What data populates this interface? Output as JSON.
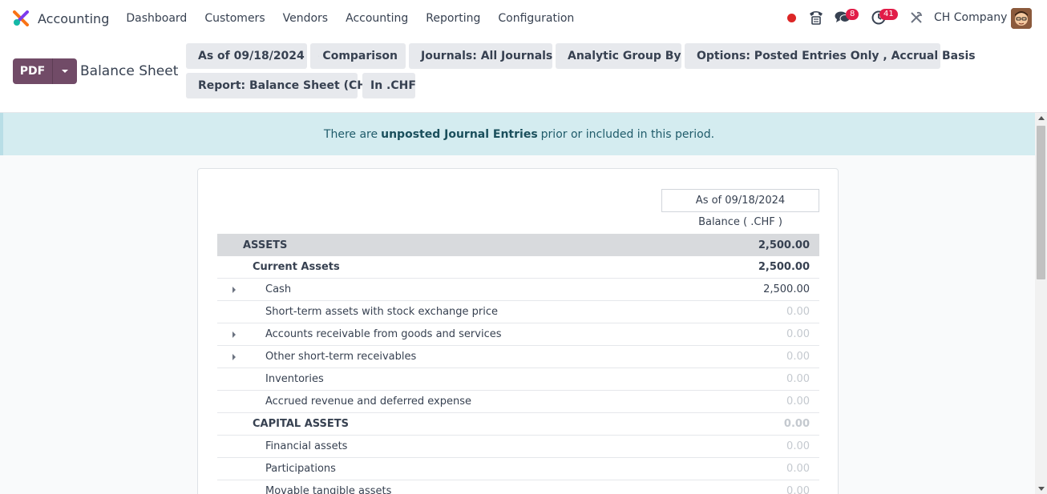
{
  "nav": {
    "app_title": "Accounting",
    "menu": [
      "Dashboard",
      "Customers",
      "Vendors",
      "Accounting",
      "Reporting",
      "Configuration"
    ],
    "messages_badge": "8",
    "activities_badge": "41",
    "company": "CH Company"
  },
  "control": {
    "pdf_label": "PDF",
    "page_title": "Balance Sheet",
    "filters": {
      "as_of": "As of 09/18/2024",
      "comparison": "Comparison",
      "journals": "Journals: All Journals",
      "analytic": "Analytic Group By",
      "options": "Options: Posted Entries Only , Accrual Basis",
      "report": "Report: Balance Sheet (CH)",
      "currency": "In .CHF"
    }
  },
  "alert": {
    "before": "There are",
    "link": "unposted Journal Entries",
    "after": "prior or included in this period."
  },
  "report": {
    "column_header": "As of 09/18/2024",
    "column_sub": "Balance ( .CHF )",
    "rows": [
      {
        "label": "ASSETS",
        "amount": "2,500.00"
      },
      {
        "label": "Current Assets",
        "amount": "2,500.00"
      },
      {
        "label": "Cash",
        "amount": "2,500.00"
      },
      {
        "label": "Short-term assets with stock exchange price",
        "amount": "0.00"
      },
      {
        "label": "Accounts receivable from goods and services",
        "amount": "0.00"
      },
      {
        "label": "Other short-term receivables",
        "amount": "0.00"
      },
      {
        "label": "Inventories",
        "amount": "0.00"
      },
      {
        "label": "Accrued revenue and deferred expense",
        "amount": "0.00"
      },
      {
        "label": "CAPITAL ASSETS",
        "amount": "0.00"
      },
      {
        "label": "Financial assets",
        "amount": "0.00"
      },
      {
        "label": "Participations",
        "amount": "0.00"
      },
      {
        "label": "Movable tangible assets",
        "amount": "0.00"
      }
    ]
  },
  "colors": {
    "brand": "#714b67",
    "alert_bg": "#d4ecf0",
    "section_bg": "#d8dadd",
    "badge": "#e11d48"
  }
}
